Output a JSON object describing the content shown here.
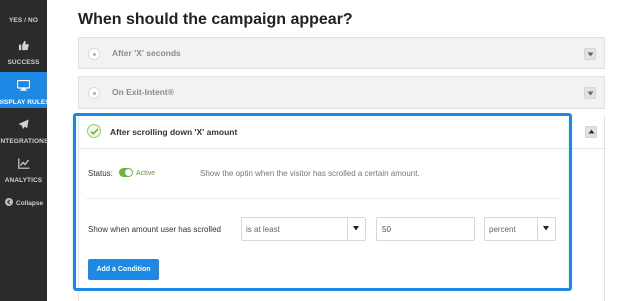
{
  "sidebar": {
    "items": [
      {
        "label": "YES / NO",
        "icon": "yes-no-icon"
      },
      {
        "label": "SUCCESS",
        "icon": "thumbs-up-icon"
      },
      {
        "label": "DISPLAY RULES",
        "icon": "monitor-icon",
        "active": true
      },
      {
        "label": "INTEGRATIONS",
        "icon": "paper-plane-icon"
      },
      {
        "label": "ANALYTICS",
        "icon": "line-chart-icon"
      }
    ],
    "collapse_label": "Collapse",
    "background": "#2b2b2b",
    "active_color": "#1e88e5"
  },
  "main": {
    "heading": "When should the campaign appear?",
    "rules": [
      {
        "label": "After 'X' seconds",
        "selected": false
      },
      {
        "label": "On Exit-Intent®",
        "selected": false
      },
      {
        "label": "After scrolling down 'X' amount",
        "selected": true
      }
    ],
    "panel": {
      "status_label": "Status:",
      "status_value": "Active",
      "description": "Show the optin when the visitor has scrolled a certain amount.",
      "condition_label": "Show when amount user has scrolled",
      "operator": "is at least",
      "amount": "50",
      "unit": "percent",
      "add_button": "Add a Condition"
    },
    "highlight_color": "#1e88e5",
    "success_color": "#6db33f"
  }
}
